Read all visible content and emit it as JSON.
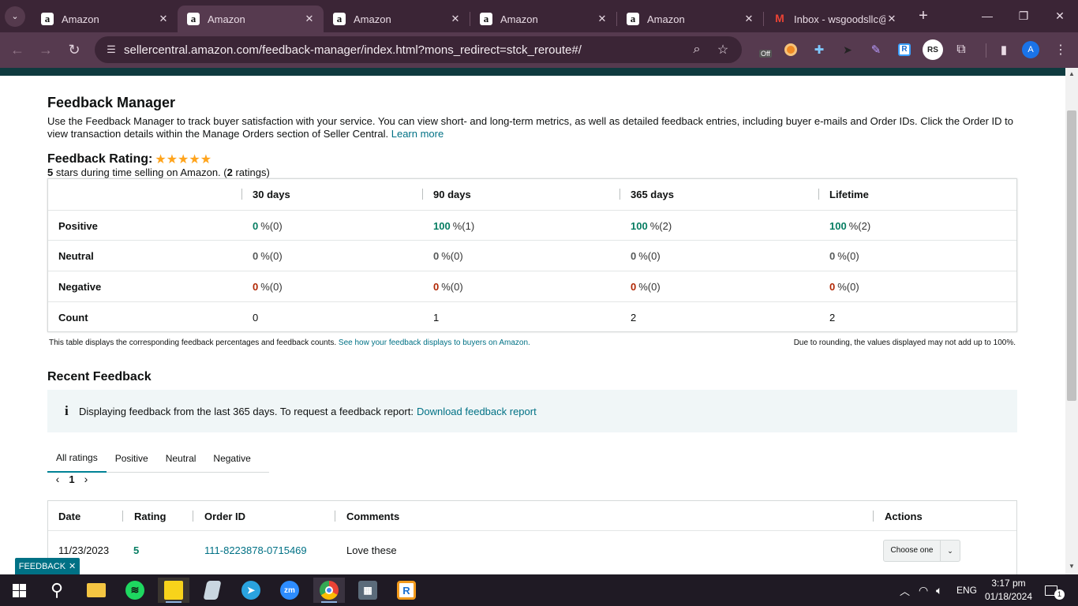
{
  "browser": {
    "tabs": [
      {
        "label": "Amazon",
        "favicon": "a"
      },
      {
        "label": "Amazon",
        "favicon": "a",
        "active": true
      },
      {
        "label": "Amazon",
        "favicon": "a"
      },
      {
        "label": "Amazon",
        "favicon": "a"
      },
      {
        "label": "Amazon",
        "favicon": "a"
      },
      {
        "label": "Inbox - wsgoodsllc@",
        "favicon": "M"
      }
    ],
    "url": "sellercentral.amazon.com/feedback-manager/index.html?mons_redirect=stck_reroute#/",
    "extension_badge": "Off",
    "profile_initials": "RS",
    "avatar_letter": "A"
  },
  "page": {
    "title": "Feedback Manager",
    "intro": "Use the Feedback Manager to track buyer satisfaction with your service. You can view short- and long-term metrics, as well as detailed feedback entries, including buyer e-mails and Order IDs. Click the Order ID to view transaction details within the Manage Orders section of Seller Central.",
    "learn_more": "Learn more",
    "rating_label": "Feedback Rating:",
    "stars": "★★★★★",
    "rating_stars_value": 5,
    "rating_summary": {
      "stars": "5",
      "text1": " stars during time selling on Amazon. (",
      "count": "2",
      "text2": " ratings)"
    },
    "metrics": {
      "columns": [
        "30 days",
        "90 days",
        "365 days",
        "Lifetime"
      ],
      "rows": [
        {
          "label": "Positive",
          "color": "green",
          "cells": [
            {
              "pct": "0",
              "rest": "%(0)"
            },
            {
              "pct": "100",
              "rest": "%(1)"
            },
            {
              "pct": "100",
              "rest": "%(2)"
            },
            {
              "pct": "100",
              "rest": "%(2)"
            }
          ]
        },
        {
          "label": "Neutral",
          "color": "gray",
          "cells": [
            {
              "pct": "0",
              "rest": "%(0)"
            },
            {
              "pct": "0",
              "rest": "%(0)"
            },
            {
              "pct": "0",
              "rest": "%(0)"
            },
            {
              "pct": "0",
              "rest": "%(0)"
            }
          ]
        },
        {
          "label": "Negative",
          "color": "red",
          "cells": [
            {
              "pct": "0",
              "rest": "%(0)"
            },
            {
              "pct": "0",
              "rest": "%(0)"
            },
            {
              "pct": "0",
              "rest": "%(0)"
            },
            {
              "pct": "0",
              "rest": "%(0)"
            }
          ]
        },
        {
          "label": "Count",
          "color": "plain",
          "cells": [
            {
              "pct": "",
              "rest": "0"
            },
            {
              "pct": "",
              "rest": "1"
            },
            {
              "pct": "",
              "rest": "2"
            },
            {
              "pct": "",
              "rest": "2"
            }
          ]
        }
      ]
    },
    "table_note": "This table displays the corresponding feedback percentages and feedback counts.",
    "table_note_link": "See how your feedback displays to buyers on Amazon.",
    "rounding_note": "Due to rounding, the values displayed may not add up to 100%.",
    "recent_title": "Recent Feedback",
    "info_text": "Displaying feedback from the last 365 days. To request a feedback report:",
    "info_link": "Download feedback report",
    "filter_tabs": [
      "All ratings",
      "Positive",
      "Neutral",
      "Negative"
    ],
    "pagination": {
      "current": "1"
    },
    "feedback_table": {
      "headers": [
        "Date",
        "Rating",
        "Order ID",
        "Comments",
        "Actions"
      ],
      "rows": [
        {
          "date": "11/23/2023",
          "rating": "5",
          "order_id": "111-8223878-0715469",
          "comment": "Love these",
          "action": "Choose one"
        }
      ]
    },
    "feedback_tag": "FEEDBACK"
  },
  "colors": {
    "link": "#007185",
    "positive": "#067d62",
    "negative": "#b12704",
    "star": "#ffa41c"
  },
  "taskbar": {
    "language": "ENG",
    "time": "3:17 pm",
    "date": "01/18/2024",
    "notification_count": "1",
    "zoom_label": "zm"
  }
}
